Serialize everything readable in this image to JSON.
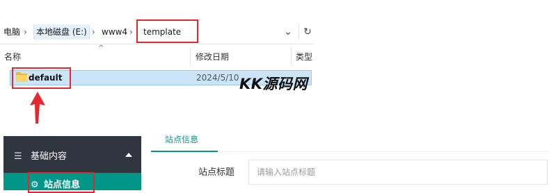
{
  "explorer": {
    "breadcrumbs": [
      "电脑",
      "本地磁盘 (E:)",
      "www4",
      "template"
    ],
    "columns": {
      "name": "名称",
      "modified": "修改日期",
      "type": "类型"
    },
    "files": [
      {
        "name": "default",
        "modified": "2024/5/10"
      }
    ]
  },
  "watermark": "KK源码网",
  "admin": {
    "menu_group": "基础内容",
    "menu_item": "站点信息",
    "tab": "站点信息",
    "field_label": "站点标题",
    "field_placeholder": "请输入站点标题"
  },
  "colors": {
    "accent": "#009688",
    "sidebar": "#2f3640",
    "highlight_box": "#e5282e",
    "selection": "#cce4f7"
  }
}
